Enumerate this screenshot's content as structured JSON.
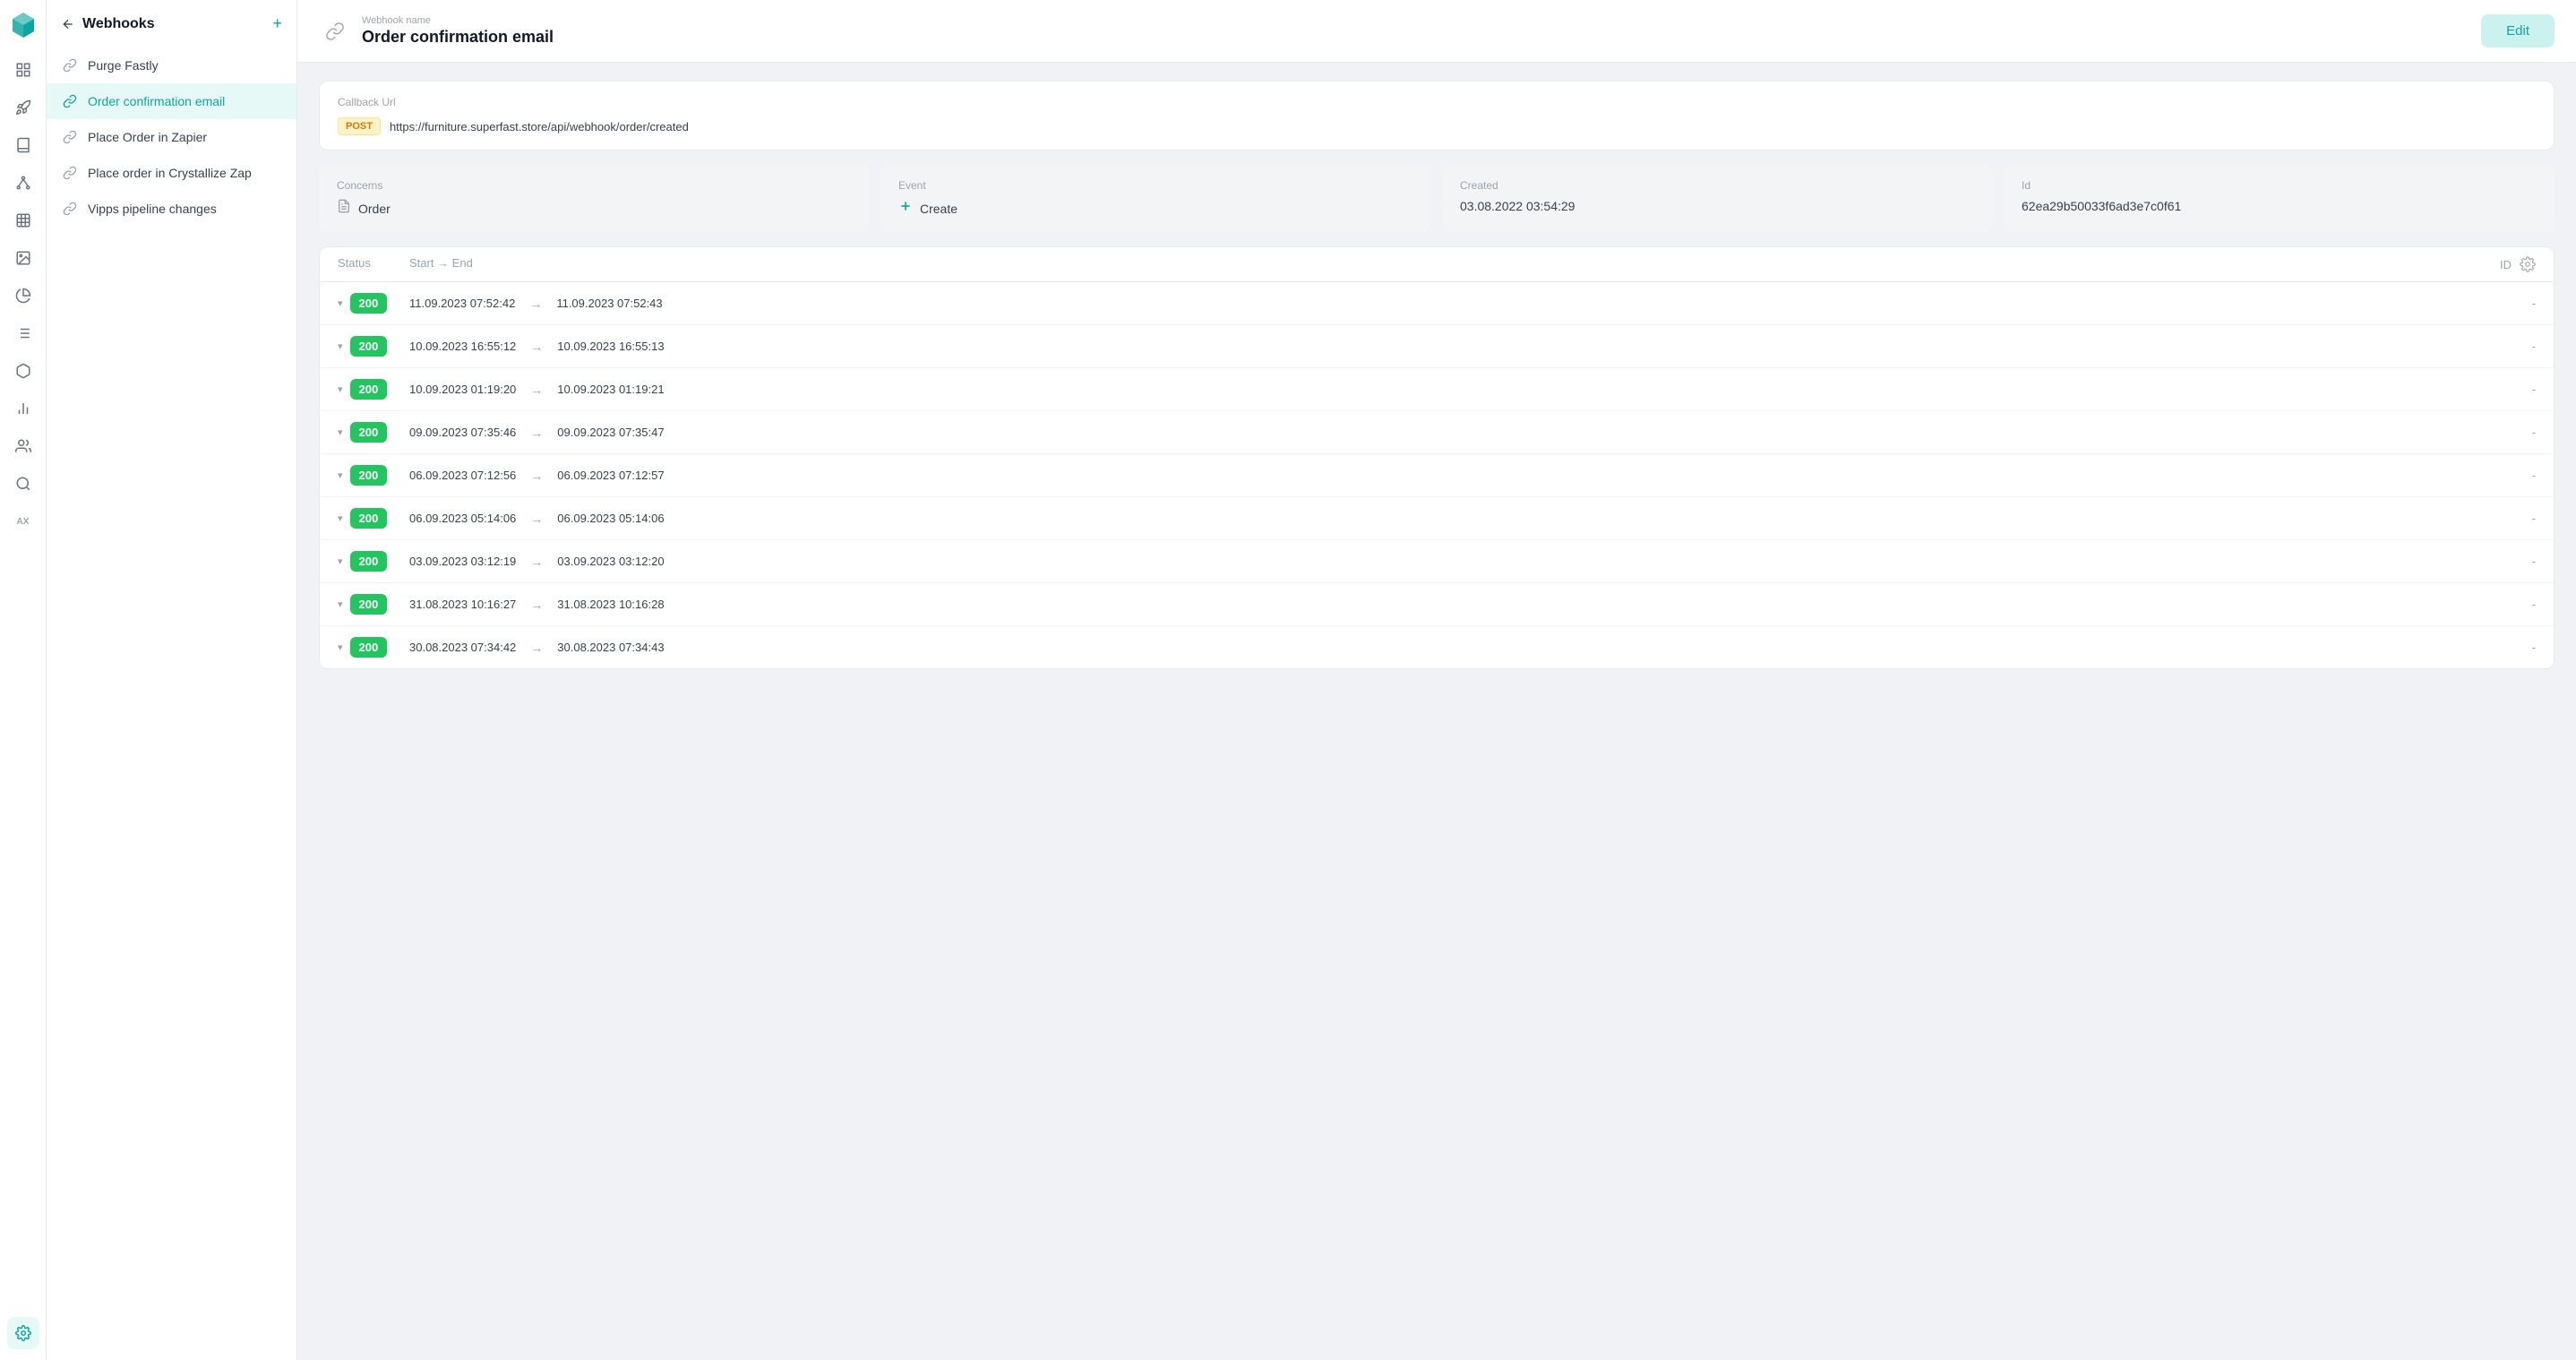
{
  "app": {
    "logo_alt": "Crystallize Logo"
  },
  "icon_bar": {
    "icons": [
      {
        "name": "dashboard-icon",
        "symbol": "⊞",
        "active": false
      },
      {
        "name": "rocket-icon",
        "symbol": "🚀",
        "active": false
      },
      {
        "name": "book-icon",
        "symbol": "📖",
        "active": false
      },
      {
        "name": "nodes-icon",
        "symbol": "⬡",
        "active": false
      },
      {
        "name": "grid-icon",
        "symbol": "▦",
        "active": false
      },
      {
        "name": "image-icon",
        "symbol": "🖼",
        "active": false
      },
      {
        "name": "analytics-icon",
        "symbol": "◎",
        "active": false
      },
      {
        "name": "list-icon",
        "symbol": "≡",
        "active": false
      },
      {
        "name": "box-icon",
        "symbol": "📦",
        "active": false
      },
      {
        "name": "chart-icon",
        "symbol": "◑",
        "active": false
      },
      {
        "name": "users-icon",
        "symbol": "👤",
        "active": false
      },
      {
        "name": "search-icon",
        "symbol": "🔍",
        "active": false
      },
      {
        "name": "ai-icon",
        "symbol": "AX",
        "active": false
      },
      {
        "name": "settings-icon",
        "symbol": "⚙",
        "active": true
      }
    ]
  },
  "sidebar": {
    "title": "Webhooks",
    "back_label": "←",
    "add_label": "+",
    "items": [
      {
        "id": "purge-fastly",
        "label": "Purge Fastly",
        "active": false
      },
      {
        "id": "order-confirmation-email",
        "label": "Order confirmation email",
        "active": true
      },
      {
        "id": "place-order-in-zapier",
        "label": "Place Order in Zapier",
        "active": false
      },
      {
        "id": "place-order-crystallize-zap",
        "label": "Place order in Crystallize Zap",
        "active": false
      },
      {
        "id": "vipps-pipeline-changes",
        "label": "Vipps pipeline changes",
        "active": false
      }
    ]
  },
  "header": {
    "webhook_name_label": "Webhook name",
    "webhook_name": "Order confirmation email",
    "edit_button": "Edit"
  },
  "callback": {
    "label": "Callback Url",
    "method": "POST",
    "url": "https://furniture.superfast.store/api/webhook/order/created"
  },
  "info_cards": [
    {
      "label": "Concerns",
      "icon": "document-icon",
      "icon_symbol": "📄",
      "value": "Order"
    },
    {
      "label": "Event",
      "icon": "plus-icon",
      "icon_symbol": "+",
      "value": "Create",
      "icon_teal": true
    },
    {
      "label": "Created",
      "icon": null,
      "value": "03.08.2022 03:54:29"
    },
    {
      "label": "Id",
      "icon": null,
      "value": "62ea29b50033f6ad3e7c0f61"
    }
  ],
  "table": {
    "columns": {
      "status": "Status",
      "start_end": "Start → End",
      "id": "ID"
    },
    "rows": [
      {
        "status": "200",
        "start": "11.09.2023 07:52:42",
        "end": "11.09.2023 07:52:43",
        "id": "-"
      },
      {
        "status": "200",
        "start": "10.09.2023 16:55:12",
        "end": "10.09.2023 16:55:13",
        "id": "-"
      },
      {
        "status": "200",
        "start": "10.09.2023 01:19:20",
        "end": "10.09.2023 01:19:21",
        "id": "-"
      },
      {
        "status": "200",
        "start": "09.09.2023 07:35:46",
        "end": "09.09.2023 07:35:47",
        "id": "-"
      },
      {
        "status": "200",
        "start": "06.09.2023 07:12:56",
        "end": "06.09.2023 07:12:57",
        "id": "-"
      },
      {
        "status": "200",
        "start": "06.09.2023 05:14:06",
        "end": "06.09.2023 05:14:06",
        "id": "-"
      },
      {
        "status": "200",
        "start": "03.09.2023 03:12:19",
        "end": "03.09.2023 03:12:20",
        "id": "-"
      },
      {
        "status": "200",
        "start": "31.08.2023 10:16:27",
        "end": "31.08.2023 10:16:28",
        "id": "-"
      },
      {
        "status": "200",
        "start": "30.08.2023 07:34:42",
        "end": "30.08.2023 07:34:43",
        "id": "-"
      }
    ]
  }
}
